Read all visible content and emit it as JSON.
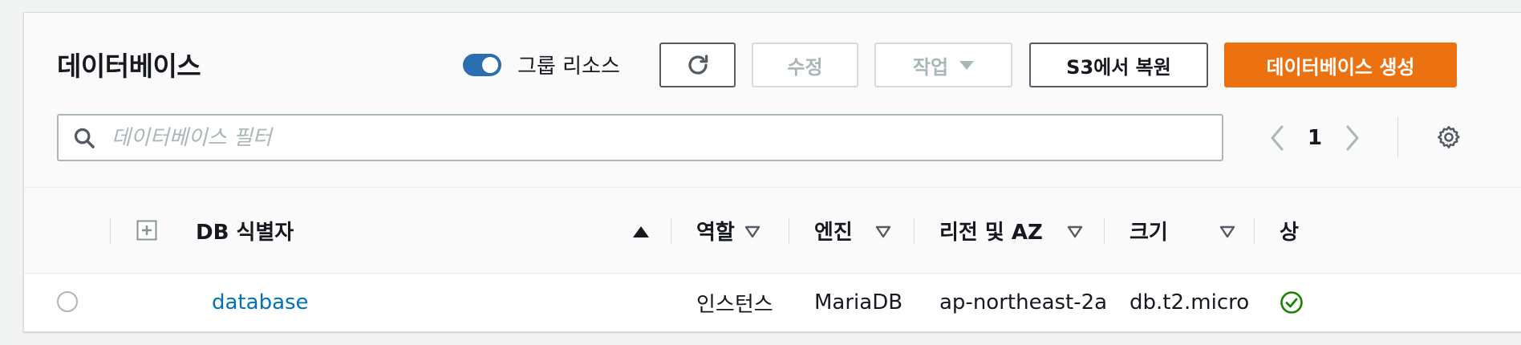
{
  "header": {
    "title": "데이터베이스",
    "group_toggle": {
      "label": "그룹 리소스",
      "on": true
    },
    "buttons": {
      "refresh": "refresh-icon",
      "edit": "수정",
      "actions": "작업",
      "restore": "S3에서 복원",
      "create": "데이터베이스 생성"
    },
    "search_placeholder": "데이터베이스 필터",
    "page": "1"
  },
  "table": {
    "columns": [
      {
        "key": "id",
        "label": "DB 식별자",
        "sorted": "asc"
      },
      {
        "key": "role",
        "label": "역할"
      },
      {
        "key": "engine",
        "label": "엔진"
      },
      {
        "key": "region",
        "label": "리전 및 AZ"
      },
      {
        "key": "size",
        "label": "크기"
      },
      {
        "key": "status",
        "label": "상"
      }
    ],
    "rows": [
      {
        "id": "database",
        "role": "인스턴스",
        "engine": "MariaDB",
        "region": "ap-northeast-2a",
        "size": "db.t2.micro",
        "status_icon": "check-circle-icon"
      }
    ]
  },
  "colors": {
    "primary": "#ec7211",
    "link": "#0073bb",
    "toggle": "#2a6fb0",
    "status_ok": "#1d8102"
  }
}
